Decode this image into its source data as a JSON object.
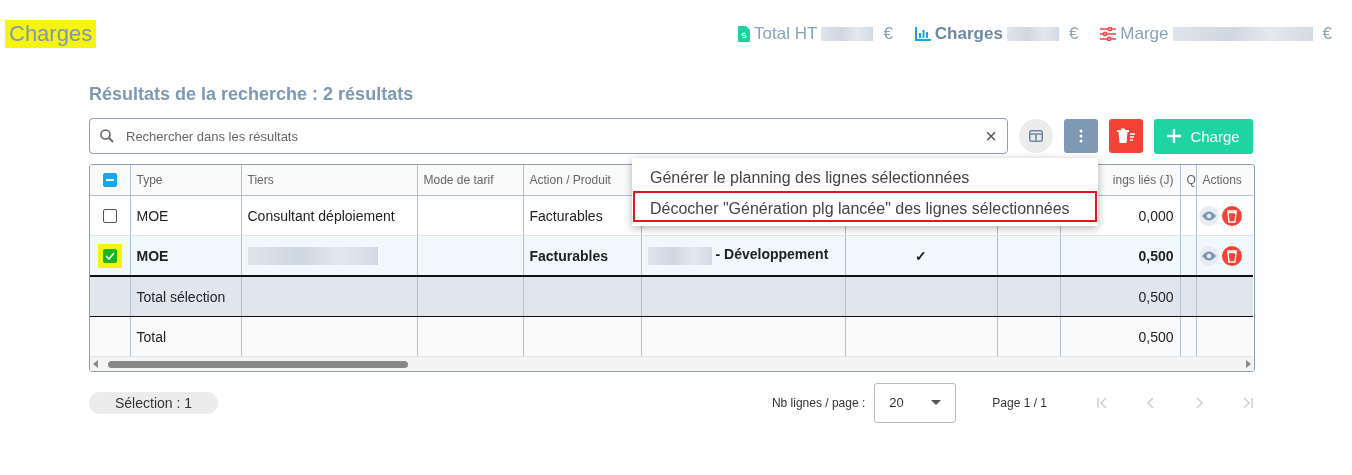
{
  "header": {
    "title": "Charges",
    "title_highlighted": true,
    "stats": [
      {
        "kind": "total",
        "label": "Total HT",
        "currency": "€"
      },
      {
        "kind": "charges",
        "label": "Charges",
        "currency": "€"
      },
      {
        "kind": "marge",
        "label": "Marge",
        "currency": "€"
      }
    ]
  },
  "results_title": "Résultats de la recherche : 2 résultats",
  "search": {
    "placeholder": "Rechercher dans les résultats",
    "clear": "×"
  },
  "add_button": {
    "label": "Charge"
  },
  "table": {
    "header_partial": true,
    "columns_left": [
      {
        "label": "Type"
      },
      {
        "label": "Tiers"
      },
      {
        "label": "Mode de tarif"
      },
      {
        "label": "Action / Produit"
      }
    ],
    "columns_right": [
      {
        "label": "ings liés (J)"
      },
      {
        "label": "Q"
      },
      {
        "label": "Actions"
      }
    ],
    "rows": [
      {
        "kind": "item",
        "checked": false,
        "selected": false,
        "cells": [
          {
            "text": "MOE"
          },
          {
            "text": "Consultant déploiement"
          },
          {
            "text": ""
          },
          {
            "text": "Facturables"
          },
          {
            "text": ""
          },
          {
            "text": ""
          },
          {
            "text": ""
          },
          {
            "text": "0,000"
          },
          {
            "text": ""
          }
        ]
      },
      {
        "kind": "item",
        "checked": true,
        "selected": true,
        "cells": [
          {
            "text": "MOE"
          },
          {
            "text": "",
            "redacted": true
          },
          {
            "text": ""
          },
          {
            "text": "Facturables"
          },
          {
            "text": "- Développement",
            "redacted": true
          },
          {
            "text": "✓"
          },
          {
            "text": ""
          },
          {
            "text": "0,500"
          },
          {
            "text": ""
          }
        ]
      },
      {
        "kind": "selection_total",
        "cells": [
          {
            "text": "Total sélection"
          },
          {
            "text": ""
          },
          {
            "text": ""
          },
          {
            "text": ""
          },
          {
            "text": ""
          },
          {
            "text": ""
          },
          {
            "text": ""
          },
          {
            "text": "0,500"
          },
          {
            "text": ""
          }
        ]
      },
      {
        "kind": "total",
        "cells": [
          {
            "text": "Total"
          },
          {
            "text": ""
          },
          {
            "text": ""
          },
          {
            "text": ""
          },
          {
            "text": ""
          },
          {
            "text": ""
          },
          {
            "text": ""
          },
          {
            "text": "0,500"
          },
          {
            "text": ""
          }
        ]
      }
    ]
  },
  "menu": {
    "items": [
      {
        "label": "Générer le planning des lignes sélectionnées",
        "selected": false
      },
      {
        "label": "Décocher \"Génération plg lancée\" des lignes sélectionnées",
        "selected": true
      }
    ]
  },
  "footer": {
    "selection": "Sélection : 1",
    "page_size_label": "Nb lignes / page :",
    "page_size": "20",
    "page_info": "Page 1 / 1"
  }
}
